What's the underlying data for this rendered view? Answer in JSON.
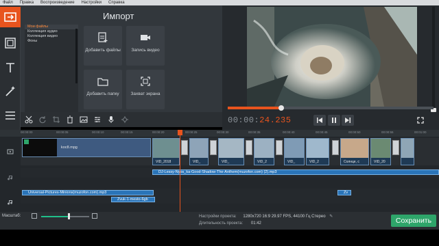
{
  "menubar": {
    "items": [
      "Файл",
      "Правка",
      "Воспроизведение",
      "Настройки",
      "Справка"
    ]
  },
  "left_toolbar": {
    "items": [
      "import-icon",
      "filmstrip-icon",
      "text-icon",
      "magic-wand-icon",
      "menu-icon"
    ],
    "active": "import-icon"
  },
  "import": {
    "title": "Импорт",
    "file_list": [
      "Мои файлы",
      "Коллекция аудио",
      "Коллекция видео",
      "Фоны"
    ],
    "selected_index": 0,
    "tiles": [
      {
        "label": "Добавить файлы",
        "icon": "add-files-icon"
      },
      {
        "label": "Запись видео",
        "icon": "camera-icon"
      },
      {
        "label": "Добавить папку",
        "icon": "folder-icon"
      },
      {
        "label": "Захват экрана",
        "icon": "screen-capture-icon"
      }
    ]
  },
  "player": {
    "timecode_dim": "00:00:",
    "timecode_hi": "24.235",
    "progress_fraction": 0.26,
    "buttons": [
      "previous-icon",
      "pause-icon",
      "next-icon"
    ],
    "fullscreen_icon": "fullscreen-icon"
  },
  "timeline_toolbar": [
    "scissors-icon",
    "redo-icon",
    "crop-icon",
    "delete-icon",
    "image-icon",
    "properties-icon",
    "microphone-icon",
    "settings-icon"
  ],
  "ruler_ticks": [
    "00:00:00",
    "00:00:05",
    "00:00:10",
    "00:00:15",
    "00:00:20",
    "00:00:25",
    "00:00:30",
    "00:00:35",
    "00:00:40",
    "00:00:45",
    "00:00:50",
    "00:00:55",
    "00:01:00"
  ],
  "tracks": {
    "title_clip": "koc8.mpg",
    "video_clip_labels": [
      "VID_2018",
      "VID_",
      "VID_",
      "VID_2",
      "VID_",
      "VID_2",
      "Солнце, с",
      "VID_20"
    ],
    "music_1": "DJ-Lessy-Nyos_ka-Good-Shadow-The-Anthem(muzofon.com) (2).mp3",
    "music_2": "Universal-Pictures-Minions(muzofon.com).mp3",
    "music_3": "Zvuk-1-mesto-6gb",
    "music_4": "Zv"
  },
  "bottom": {
    "zoom_label": "Масштаб:",
    "zoom_level": 0.55,
    "settings_label": "Настройки проекта:",
    "settings_value": "1280x720 16:9 29.97 FPS, 44100 Гц Стерео",
    "duration_label": "Длительность проекта:",
    "duration_value": "01:42",
    "save_label": "Сохранить"
  },
  "colors": {
    "accent": "#e8541e",
    "save": "#2ea56a",
    "clip_border": "#6a8fb5",
    "audio": "#2a74b8"
  }
}
